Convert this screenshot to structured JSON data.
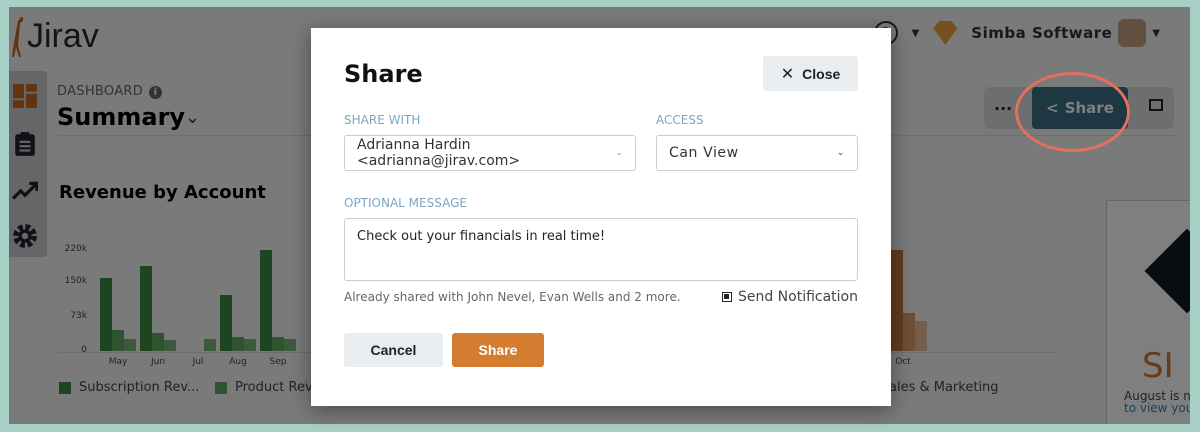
{
  "app": {
    "logo": "Jirav",
    "org": "Simba Software"
  },
  "header": {
    "section": "DASHBOARD",
    "title": "Summary"
  },
  "toolbar": {
    "more": "···",
    "share": "Share"
  },
  "card": {
    "big": "SI",
    "line1": "August is no",
    "line2": "to view your"
  },
  "chart_data": {
    "type": "bar",
    "title": "Revenue by Account",
    "yticks": [
      "0",
      "73k",
      "150k",
      "220k"
    ],
    "ylim": [
      0,
      220000
    ],
    "categories": [
      "May",
      "Jun",
      "Jul",
      "Aug",
      "Sep"
    ],
    "series": [
      {
        "name": "Subscription Rev...",
        "color": "#3a8a3e",
        "values": [
          160000,
          186000,
          0,
          121000,
          220000
        ]
      },
      {
        "name": "Product Reve",
        "color": "#5ea45f",
        "values": [
          45000,
          40000,
          0,
          31000,
          31000
        ]
      },
      {
        "values": [
          27000,
          25000,
          27000,
          27000,
          27000
        ],
        "color": "#7cb57b"
      }
    ],
    "extra": {
      "category": "Oct",
      "legend": "ales & Marketing",
      "colors": [
        "#c9773a",
        "#dd9c6a",
        "#e8bb98"
      ],
      "values": [
        220000,
        83000,
        65000
      ]
    }
  },
  "modal": {
    "title": "Share",
    "close": "Close",
    "share_with_label": "SHARE WITH",
    "share_with_value": "Adrianna Hardin <adrianna@jirav.com>",
    "access_label": "ACCESS",
    "access_value": "Can View",
    "message_label": "OPTIONAL MESSAGE",
    "message_value": "Check out your financials in real time!",
    "already_shared": "Already shared with John Nevel, Evan Wells and 2 more.",
    "send_notification": "Send Notification",
    "send_notification_checked": true,
    "cancel": "Cancel",
    "share": "Share",
    "accent": "#d47c30"
  }
}
